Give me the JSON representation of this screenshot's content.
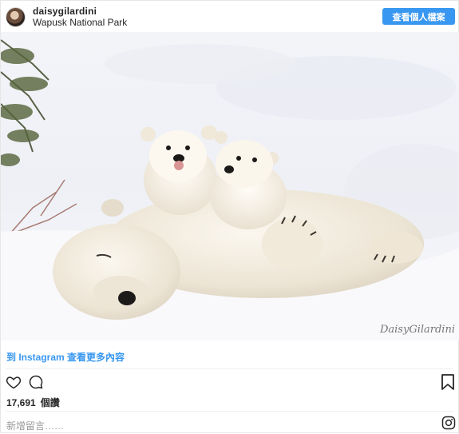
{
  "header": {
    "username": "daisygilardini",
    "location": "Wapusk National Park",
    "view_profile": "查看個人檔案"
  },
  "photo": {
    "signature": "DaisyGilardini"
  },
  "more_link": "到 Instagram 查看更多內容",
  "actions": {
    "likes_count": "17,691",
    "likes_label": "個讚"
  },
  "comment": {
    "placeholder": "新增留言……"
  },
  "icons": {
    "like": "heart-outline-icon",
    "comment": "speech-bubble-icon",
    "save": "bookmark-icon",
    "brand": "instagram-icon"
  },
  "colors": {
    "accent": "#3897f0",
    "text": "#262626",
    "muted": "#999999"
  }
}
